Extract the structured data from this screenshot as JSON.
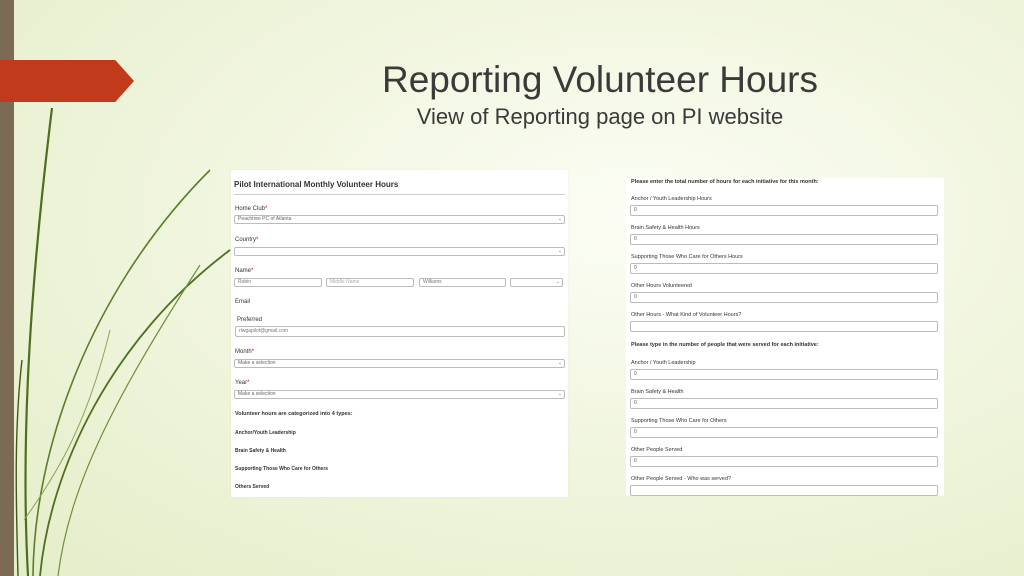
{
  "slide": {
    "title": "Reporting Volunteer Hours",
    "subtitle": "View of Reporting page on PI website"
  },
  "left_form": {
    "title": "Pilot International Monthly Volunteer Hours",
    "home_club_label": "Home Club",
    "home_club_value": "Peachtree PC of Atlanta",
    "country_label": "Country",
    "country_value": "",
    "name_label": "Name",
    "first_name": "Robin",
    "middle_placeholder": "Middle Name",
    "last_name": "Williams",
    "email_label": "Email",
    "preferred_label": "Preferred",
    "email_value": "rlwgapilot@gmail.com",
    "month_label": "Month",
    "month_value": "Make a selection",
    "year_label": "Year",
    "year_value": "Make a selection",
    "categories_heading": "Volunteer hours are categorized into 4 types:",
    "categories": [
      "Anchor/Youth Leadership",
      "Brain Safety & Health",
      "Supporting Those Who Care for Others",
      "Others Served"
    ],
    "required_mark": "*"
  },
  "right_form": {
    "hours_heading": "Please enter the total number of hours for each initiative for this month:",
    "hours_fields": [
      {
        "label": "Anchor / Youth Leadership Hours",
        "value": "0"
      },
      {
        "label": "Brain Safety & Health Hours",
        "value": "0"
      },
      {
        "label": "Supporting Those Who Care for Others Hours",
        "value": "0"
      },
      {
        "label": "Other Hours Volunteered",
        "value": "0"
      },
      {
        "label": "Other Hours - What Kind of Volunteer Hours?",
        "value": ""
      }
    ],
    "people_heading": "Please type in the number of people that were served for each initiative:",
    "people_fields": [
      {
        "label": "Anchor / Youth Leadership",
        "value": "0"
      },
      {
        "label": "Brain Safety & Health",
        "value": "0"
      },
      {
        "label": "Supporting Those Who Care for Others",
        "value": "0"
      },
      {
        "label": "Other People Served",
        "value": "0"
      },
      {
        "label": "Other People Served - Who was served?",
        "value": ""
      }
    ]
  },
  "colors": {
    "accent_red": "#c23a1c",
    "left_bar": "#7b6b55",
    "swoosh_green": "#4e6f1f"
  }
}
